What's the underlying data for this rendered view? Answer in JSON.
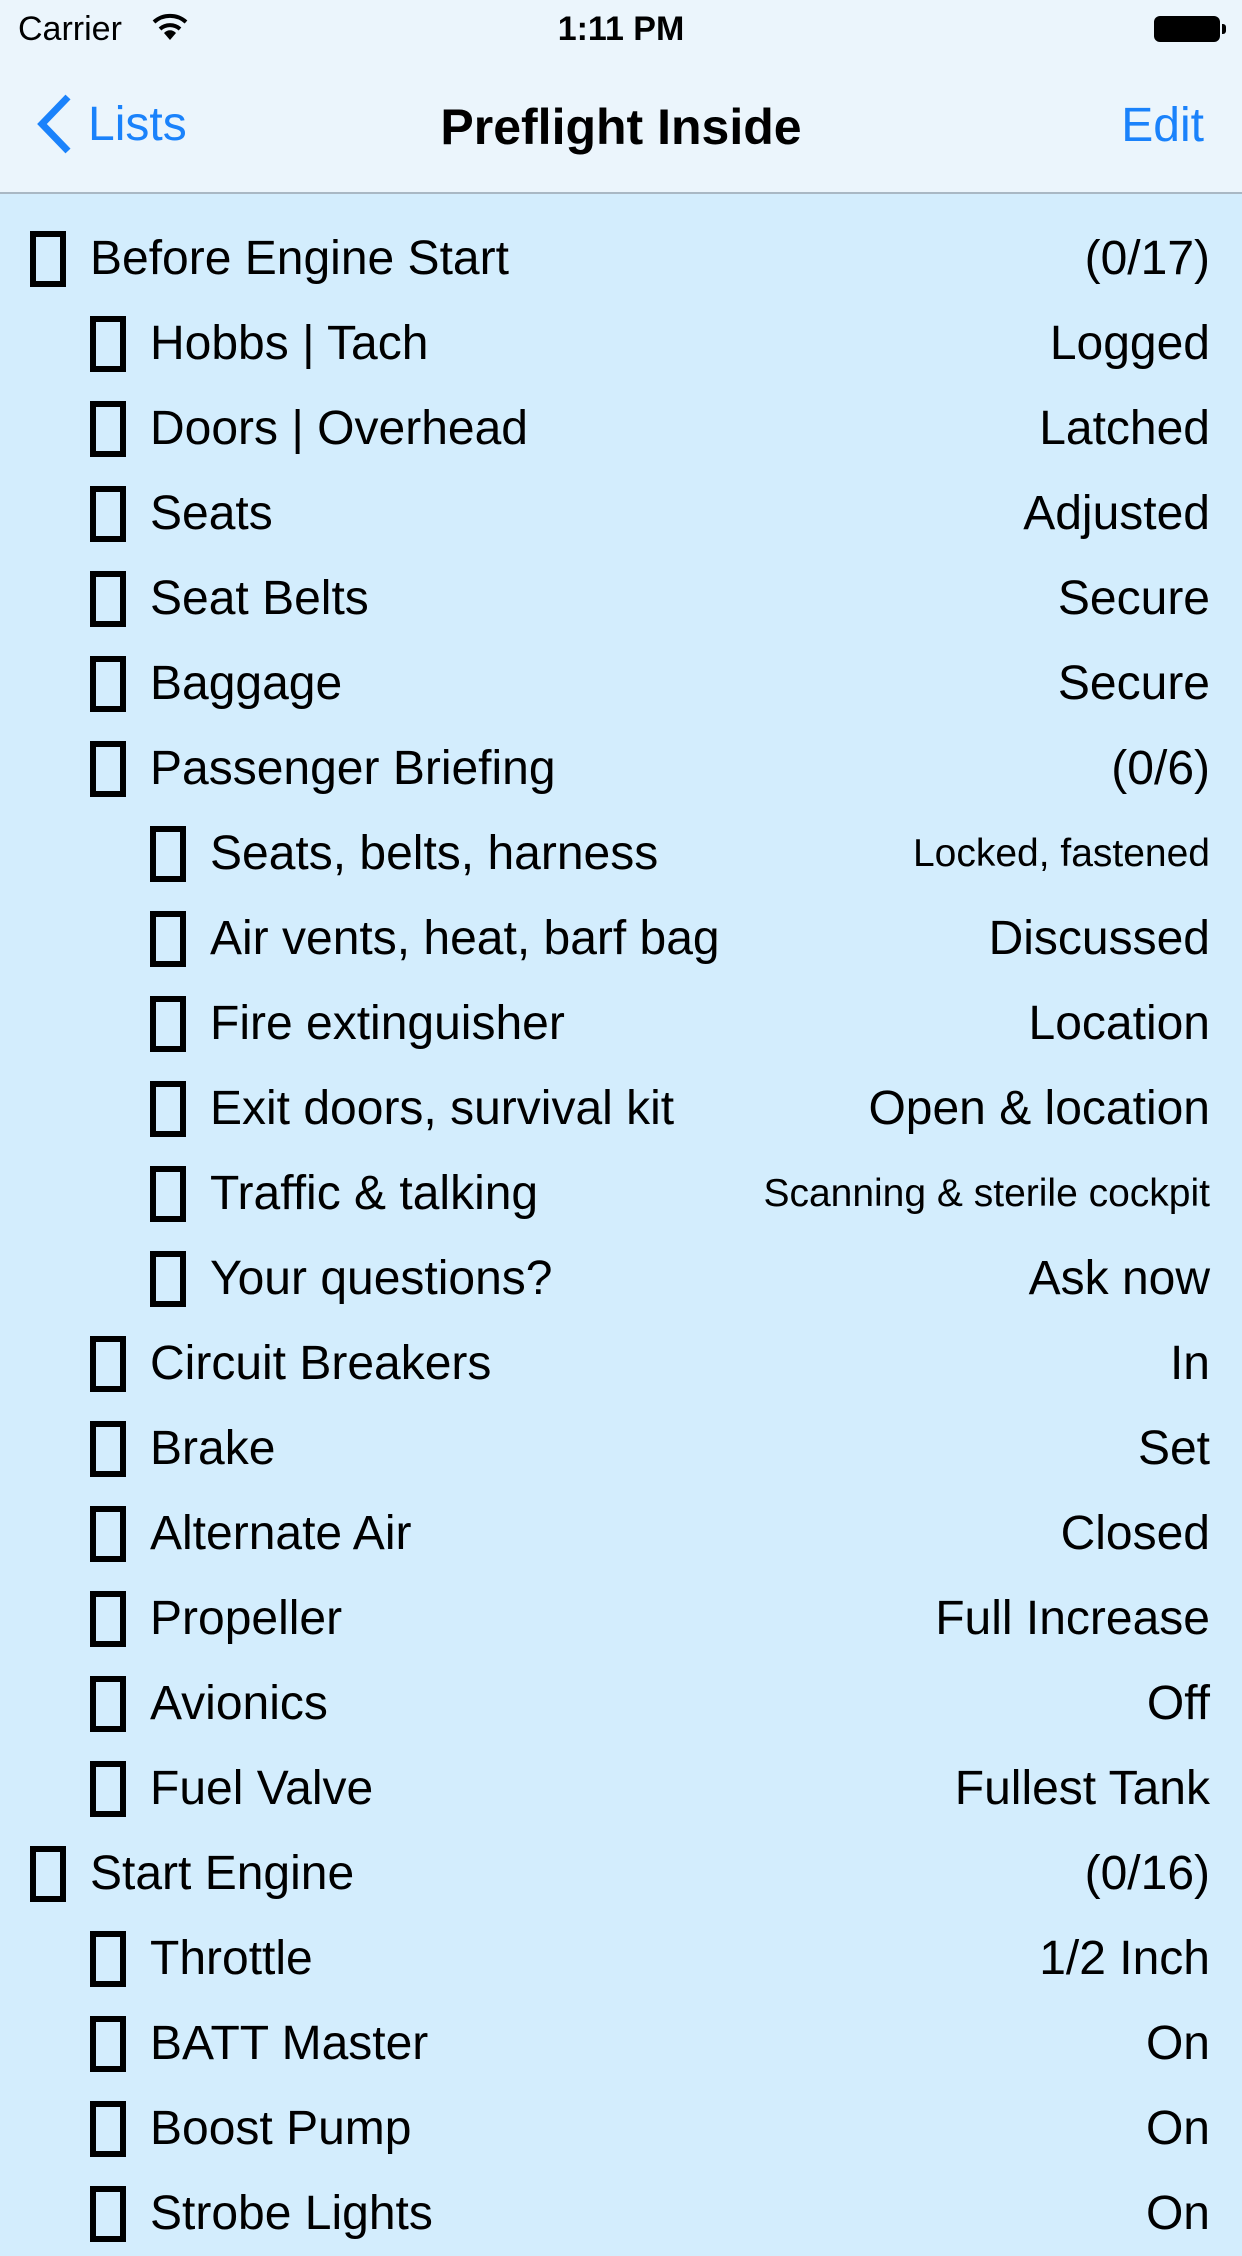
{
  "status_bar": {
    "carrier": "Carrier",
    "time": "1:11 PM"
  },
  "nav": {
    "back_label": "Lists",
    "title": "Preflight Inside",
    "edit_label": "Edit"
  },
  "items": [
    {
      "label": "Before Engine Start",
      "value": "(0/17)",
      "level": 0
    },
    {
      "label": "Hobbs | Tach",
      "value": "Logged",
      "level": 1
    },
    {
      "label": "Doors | Overhead",
      "value": "Latched",
      "level": 1
    },
    {
      "label": "Seats",
      "value": "Adjusted",
      "level": 1
    },
    {
      "label": "Seat Belts",
      "value": "Secure",
      "level": 1
    },
    {
      "label": "Baggage",
      "value": "Secure",
      "level": 1
    },
    {
      "label": "Passenger Briefing",
      "value": "(0/6)",
      "level": 1
    },
    {
      "label": "Seats, belts, harness",
      "value": "Locked, fastened",
      "level": 2,
      "small": true
    },
    {
      "label": "Air vents, heat, barf bag",
      "value": "Discussed",
      "level": 2
    },
    {
      "label": "Fire extinguisher",
      "value": "Location",
      "level": 2
    },
    {
      "label": "Exit doors, survival kit",
      "value": "Open & location",
      "level": 2
    },
    {
      "label": "Traffic & talking",
      "value": "Scanning & sterile cockpit",
      "level": 2,
      "small": true
    },
    {
      "label": "Your questions?",
      "value": "Ask now",
      "level": 2
    },
    {
      "label": "Circuit Breakers",
      "value": "In",
      "level": 1
    },
    {
      "label": "Brake",
      "value": "Set",
      "level": 1
    },
    {
      "label": "Alternate Air",
      "value": "Closed",
      "level": 1
    },
    {
      "label": "Propeller",
      "value": "Full Increase",
      "level": 1
    },
    {
      "label": "Avionics",
      "value": "Off",
      "level": 1
    },
    {
      "label": "Fuel Valve",
      "value": "Fullest Tank",
      "level": 1
    },
    {
      "label": "Start Engine",
      "value": "(0/16)",
      "level": 0
    },
    {
      "label": "Throttle",
      "value": "1/2 Inch",
      "level": 1
    },
    {
      "label": "BATT Master",
      "value": "On",
      "level": 1
    },
    {
      "label": "Boost Pump",
      "value": "On",
      "level": 1
    },
    {
      "label": "Strobe Lights",
      "value": "On",
      "level": 1
    }
  ]
}
